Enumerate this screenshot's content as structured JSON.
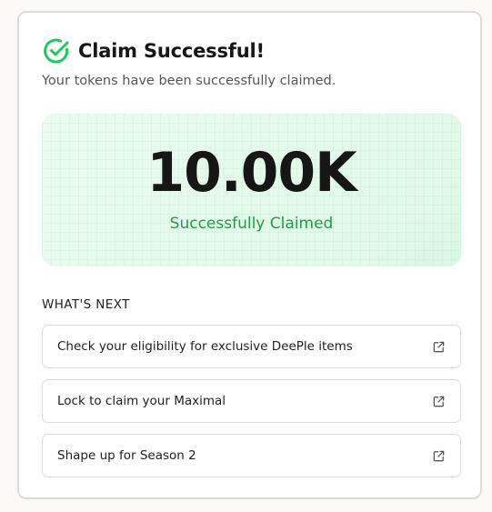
{
  "header": {
    "title": "Claim Successful!",
    "icon": "check-circle-icon",
    "accent": "#22c55e"
  },
  "subtitle": "Your tokens have been successfully claimed.",
  "hero": {
    "amount": "10.00K",
    "status": "Successfully Claimed",
    "status_color": "#1f9d4a"
  },
  "next": {
    "heading": "WHAT'S NEXT",
    "items": [
      {
        "label": "Check your eligibility for exclusive DeePle items",
        "icon": "external-link-icon"
      },
      {
        "label": "Lock to claim your Maximal",
        "icon": "external-link-icon"
      },
      {
        "label": "Shape up for Season 2",
        "icon": "external-link-icon"
      }
    ]
  }
}
